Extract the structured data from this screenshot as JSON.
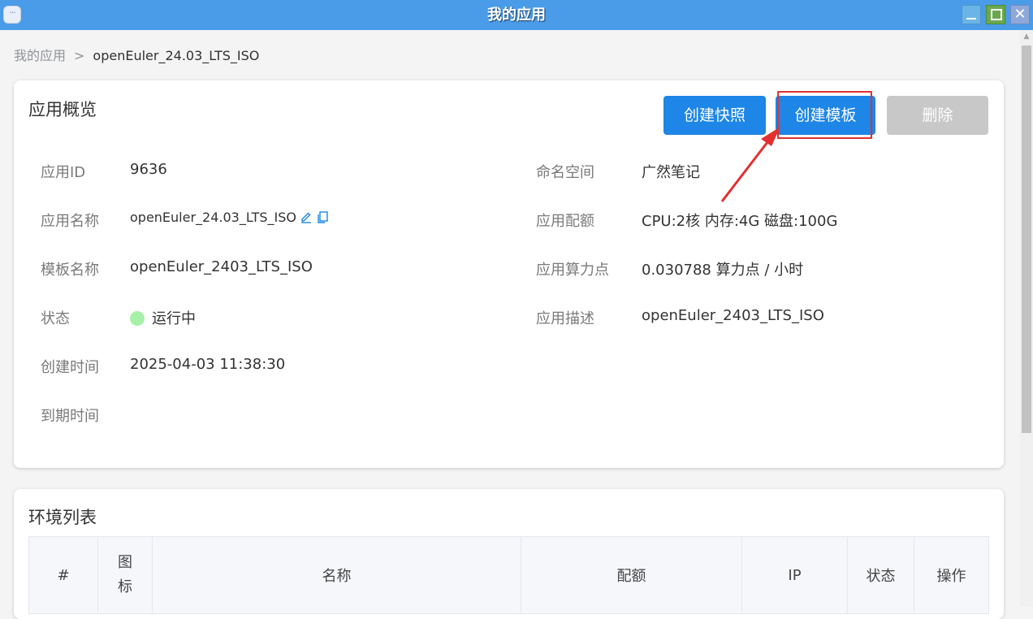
{
  "window": {
    "title": "我的应用",
    "close_glyph": "✕"
  },
  "breadcrumb": {
    "root": "我的应用",
    "separator": ">",
    "current": "openEuler_24.03_LTS_ISO"
  },
  "overview": {
    "title": "应用概览",
    "buttons": {
      "snapshot": "创建快照",
      "template": "创建模板",
      "delete": "删除"
    },
    "left_fields": [
      {
        "label": "应用ID",
        "value": "9636"
      },
      {
        "label": "应用名称",
        "value": "openEuler_24.03_LTS_ISO"
      },
      {
        "label": "模板名称",
        "value": "openEuler_2403_LTS_ISO"
      },
      {
        "label": "状态",
        "value": "运行中"
      },
      {
        "label": "创建时间",
        "value": "2025-04-03 11:38:30"
      },
      {
        "label": "到期时间",
        "value": ""
      }
    ],
    "right_fields": [
      {
        "label": "命名空间",
        "value": "广然笔记"
      },
      {
        "label": "应用配额",
        "value": "CPU:2核 内存:4G 磁盘:100G"
      },
      {
        "label": "应用算力点",
        "value": "0.030788 算力点 / 小时"
      },
      {
        "label": "应用描述",
        "value": "openEuler_2403_LTS_ISO"
      }
    ]
  },
  "environments": {
    "title": "环境列表",
    "columns": [
      "#",
      "图标",
      "名称",
      "配额",
      "IP",
      "状态",
      "操作"
    ]
  },
  "colors": {
    "titlebar": "#4a9be8",
    "primary_button": "#1d86e6",
    "disabled_button": "#c8c8c8",
    "highlight": "#e23030",
    "status_running": "#a6f0a8"
  }
}
